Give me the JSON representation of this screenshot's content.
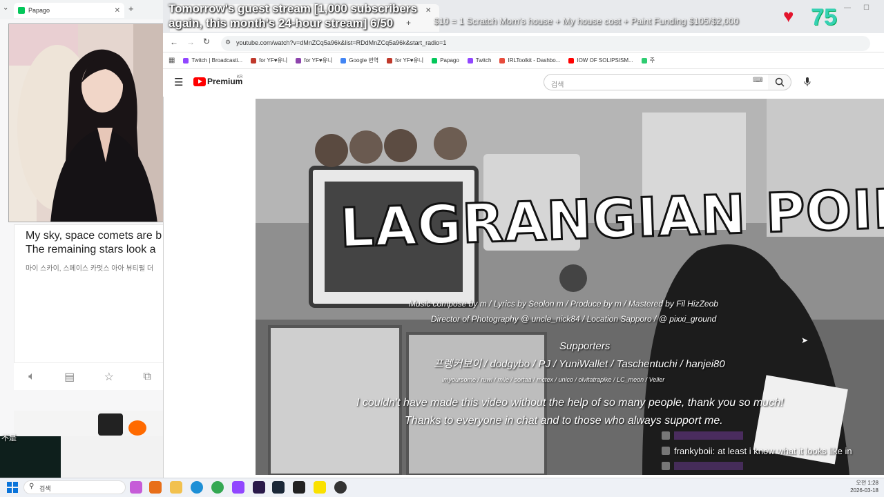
{
  "left_browser": {
    "tab_title": "Papago",
    "papago": {
      "line1": "My sky, space comets are b",
      "line2": "The remaining stars look a",
      "korean": "마이 스카이, 스페이스 카멋스 아아 뷰티펄 더",
      "bottom_label": "不是"
    }
  },
  "overlay": {
    "title_line1": "Tomorrow's guest stream [1,000 subscribers",
    "title_line2": "again, this month's 24-hour stream] 6/50",
    "funding_text": "$10 = 1 Scratch Mom's house + My house cost + Paint Funding $105/$2,000",
    "heart_count": "75"
  },
  "browser": {
    "url": "youtube.com/watch?v=dMnZCq5a96k&list=RDdMnZCq5a96k&start_radio=1",
    "bookmarks": [
      {
        "label": "Twitch | Broadcasti...",
        "color": "#9146ff"
      },
      {
        "label": "for YF♥유니",
        "color": "#c0392b"
      },
      {
        "label": "for YF♥유니",
        "color": "#8e44ad"
      },
      {
        "label": "Google 번역",
        "color": "#4285f4"
      },
      {
        "label": "for YF♥유니",
        "color": "#c0392b"
      },
      {
        "label": "Papago",
        "color": "#03c75a"
      },
      {
        "label": "Twitch",
        "color": "#9146ff"
      },
      {
        "label": "IRLToolkit - Dashbo...",
        "color": "#e74c3c"
      },
      {
        "label": "IOW OF SOLIPSISM...",
        "color": "#ff0000"
      },
      {
        "label": "주",
        "color": "#2ecc71"
      }
    ]
  },
  "youtube": {
    "logo_text": "Premium",
    "logo_sup": "KR",
    "search_placeholder": "검색"
  },
  "video": {
    "title": "LAGRANGIAN POINT",
    "credits1": "Music compose by m / Lyrics by Seolon m / Produce by m / Mastered by Fil HizZeob",
    "credits2": "Director of Photography @ uncle_nick84 / Location Sapporo / @ pixxi_ground",
    "supporters_heading": "Supporters",
    "supporters_line": "프렝커보이 / dodgybo / PJ / YuniWallet / Taschentuchi / hanjei80",
    "small_line": "imyoursome / ruwi / mile / sortaa / mctex / unico / olvitatrapike / LC_meon / Veller",
    "thanks1": "I couldn't have made this video without the help of so many people, thank you so much!",
    "thanks2": "Thanks to everyone in chat and to those who always support me."
  },
  "chat": [
    {
      "user": "",
      "message": "",
      "user_color": "#9b59b6"
    },
    {
      "user": "frankyboii:",
      "message": "at least i know what it looks like in",
      "user_color": "#ffffff"
    },
    {
      "user": "",
      "message": "",
      "user_color": "#8e44ad"
    }
  ],
  "taskbar": {
    "search_label": "검색",
    "time": "오전 1:28",
    "date": "2026-03-18"
  }
}
